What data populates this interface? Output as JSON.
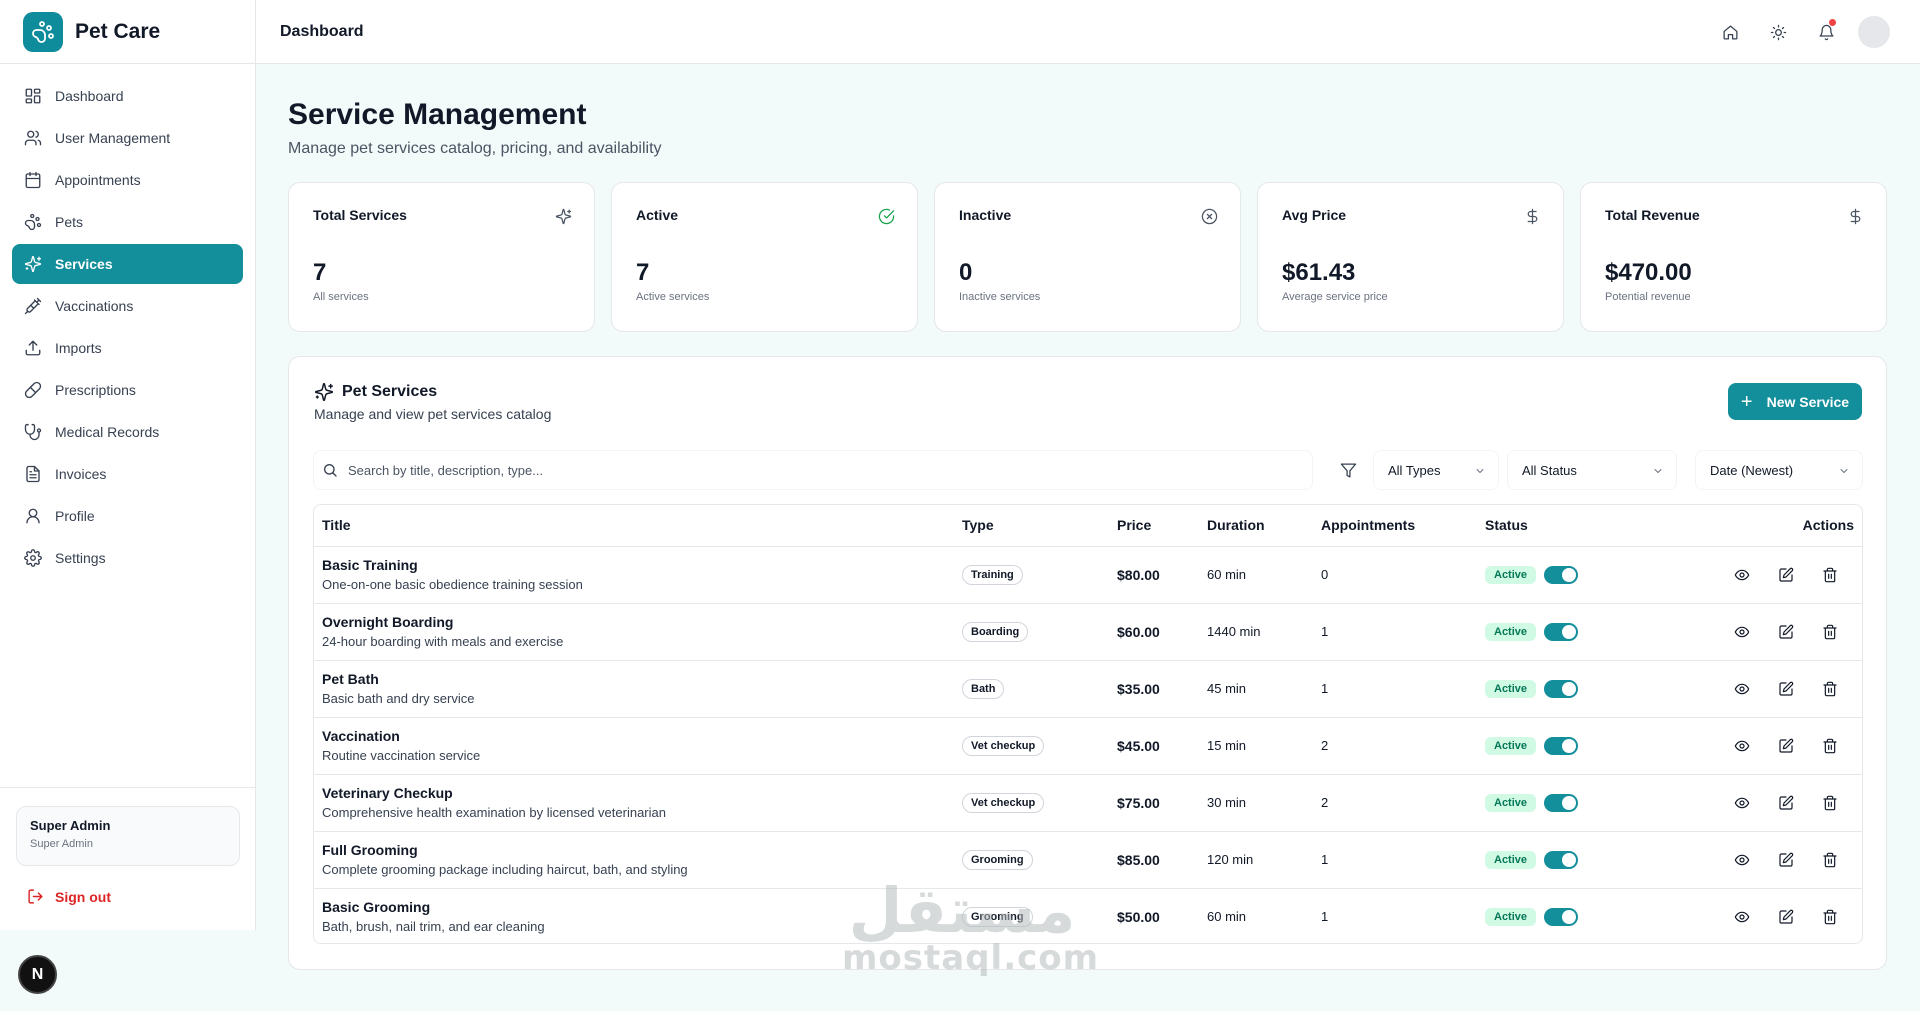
{
  "app": {
    "name": "Pet Care"
  },
  "sidebar": {
    "items": [
      {
        "label": "Dashboard",
        "icon": "dashboard-icon"
      },
      {
        "label": "User Management",
        "icon": "users-icon"
      },
      {
        "label": "Appointments",
        "icon": "calendar-icon"
      },
      {
        "label": "Pets",
        "icon": "paw-icon"
      },
      {
        "label": "Services",
        "icon": "sparkles-icon",
        "active": true
      },
      {
        "label": "Vaccinations",
        "icon": "syringe-icon"
      },
      {
        "label": "Imports",
        "icon": "upload-icon"
      },
      {
        "label": "Prescriptions",
        "icon": "pill-icon"
      },
      {
        "label": "Medical Records",
        "icon": "stethoscope-icon"
      },
      {
        "label": "Invoices",
        "icon": "file-icon"
      },
      {
        "label": "Profile",
        "icon": "user-icon"
      },
      {
        "label": "Settings",
        "icon": "gear-icon"
      }
    ],
    "user": {
      "name": "Super Admin",
      "role": "Super Admin"
    },
    "signout": "Sign out",
    "badge": "N"
  },
  "header": {
    "title": "Dashboard"
  },
  "page": {
    "title": "Service Management",
    "subtitle": "Manage pet services catalog, pricing, and availability"
  },
  "stats": [
    {
      "label": "Total Services",
      "value": "7",
      "desc": "All services",
      "icon": "sparkles-icon"
    },
    {
      "label": "Active",
      "value": "7",
      "desc": "Active services",
      "icon": "check-circle-icon",
      "icon_color": "#16a34a"
    },
    {
      "label": "Inactive",
      "value": "0",
      "desc": "Inactive services",
      "icon": "x-circle-icon"
    },
    {
      "label": "Avg Price",
      "value": "$61.43",
      "desc": "Average service price",
      "icon": "dollar-icon"
    },
    {
      "label": "Total Revenue",
      "value": "$470.00",
      "desc": "Potential revenue",
      "icon": "dollar-icon"
    }
  ],
  "services_card": {
    "title": "Pet Services",
    "subtitle": "Manage and view pet services catalog",
    "new_button": "New Service",
    "search_placeholder": "Search by title, description, type...",
    "filters": {
      "type": "All Types",
      "status": "All Status",
      "sort": "Date (Newest)"
    },
    "columns": [
      "Title",
      "Type",
      "Price",
      "Duration",
      "Appointments",
      "Status",
      "Actions"
    ],
    "rows": [
      {
        "title": "Basic Training",
        "desc": "One-on-one basic obedience training session",
        "type": "Training",
        "price": "$80.00",
        "duration": "60 min",
        "appointments": "0",
        "status": "Active"
      },
      {
        "title": "Overnight Boarding",
        "desc": "24-hour boarding with meals and exercise",
        "type": "Boarding",
        "price": "$60.00",
        "duration": "1440 min",
        "appointments": "1",
        "status": "Active"
      },
      {
        "title": "Pet Bath",
        "desc": "Basic bath and dry service",
        "type": "Bath",
        "price": "$35.00",
        "duration": "45 min",
        "appointments": "1",
        "status": "Active"
      },
      {
        "title": "Vaccination",
        "desc": "Routine vaccination service",
        "type": "Vet checkup",
        "price": "$45.00",
        "duration": "15 min",
        "appointments": "2",
        "status": "Active"
      },
      {
        "title": "Veterinary Checkup",
        "desc": "Comprehensive health examination by licensed veterinarian",
        "type": "Vet checkup",
        "price": "$75.00",
        "duration": "30 min",
        "appointments": "2",
        "status": "Active"
      },
      {
        "title": "Full Grooming",
        "desc": "Complete grooming package including haircut, bath, and styling",
        "type": "Grooming",
        "price": "$85.00",
        "duration": "120 min",
        "appointments": "1",
        "status": "Active"
      },
      {
        "title": "Basic Grooming",
        "desc": "Bath, brush, nail trim, and ear cleaning",
        "type": "Grooming",
        "price": "$50.00",
        "duration": "60 min",
        "appointments": "1",
        "status": "Active"
      }
    ]
  },
  "watermark": {
    "arabic": "مستقل",
    "latin": "mostaql.com"
  },
  "colors": {
    "accent": "#138e9b",
    "active_badge_bg": "#d1fae5",
    "active_badge_text": "#047857",
    "danger": "#dc2626"
  }
}
